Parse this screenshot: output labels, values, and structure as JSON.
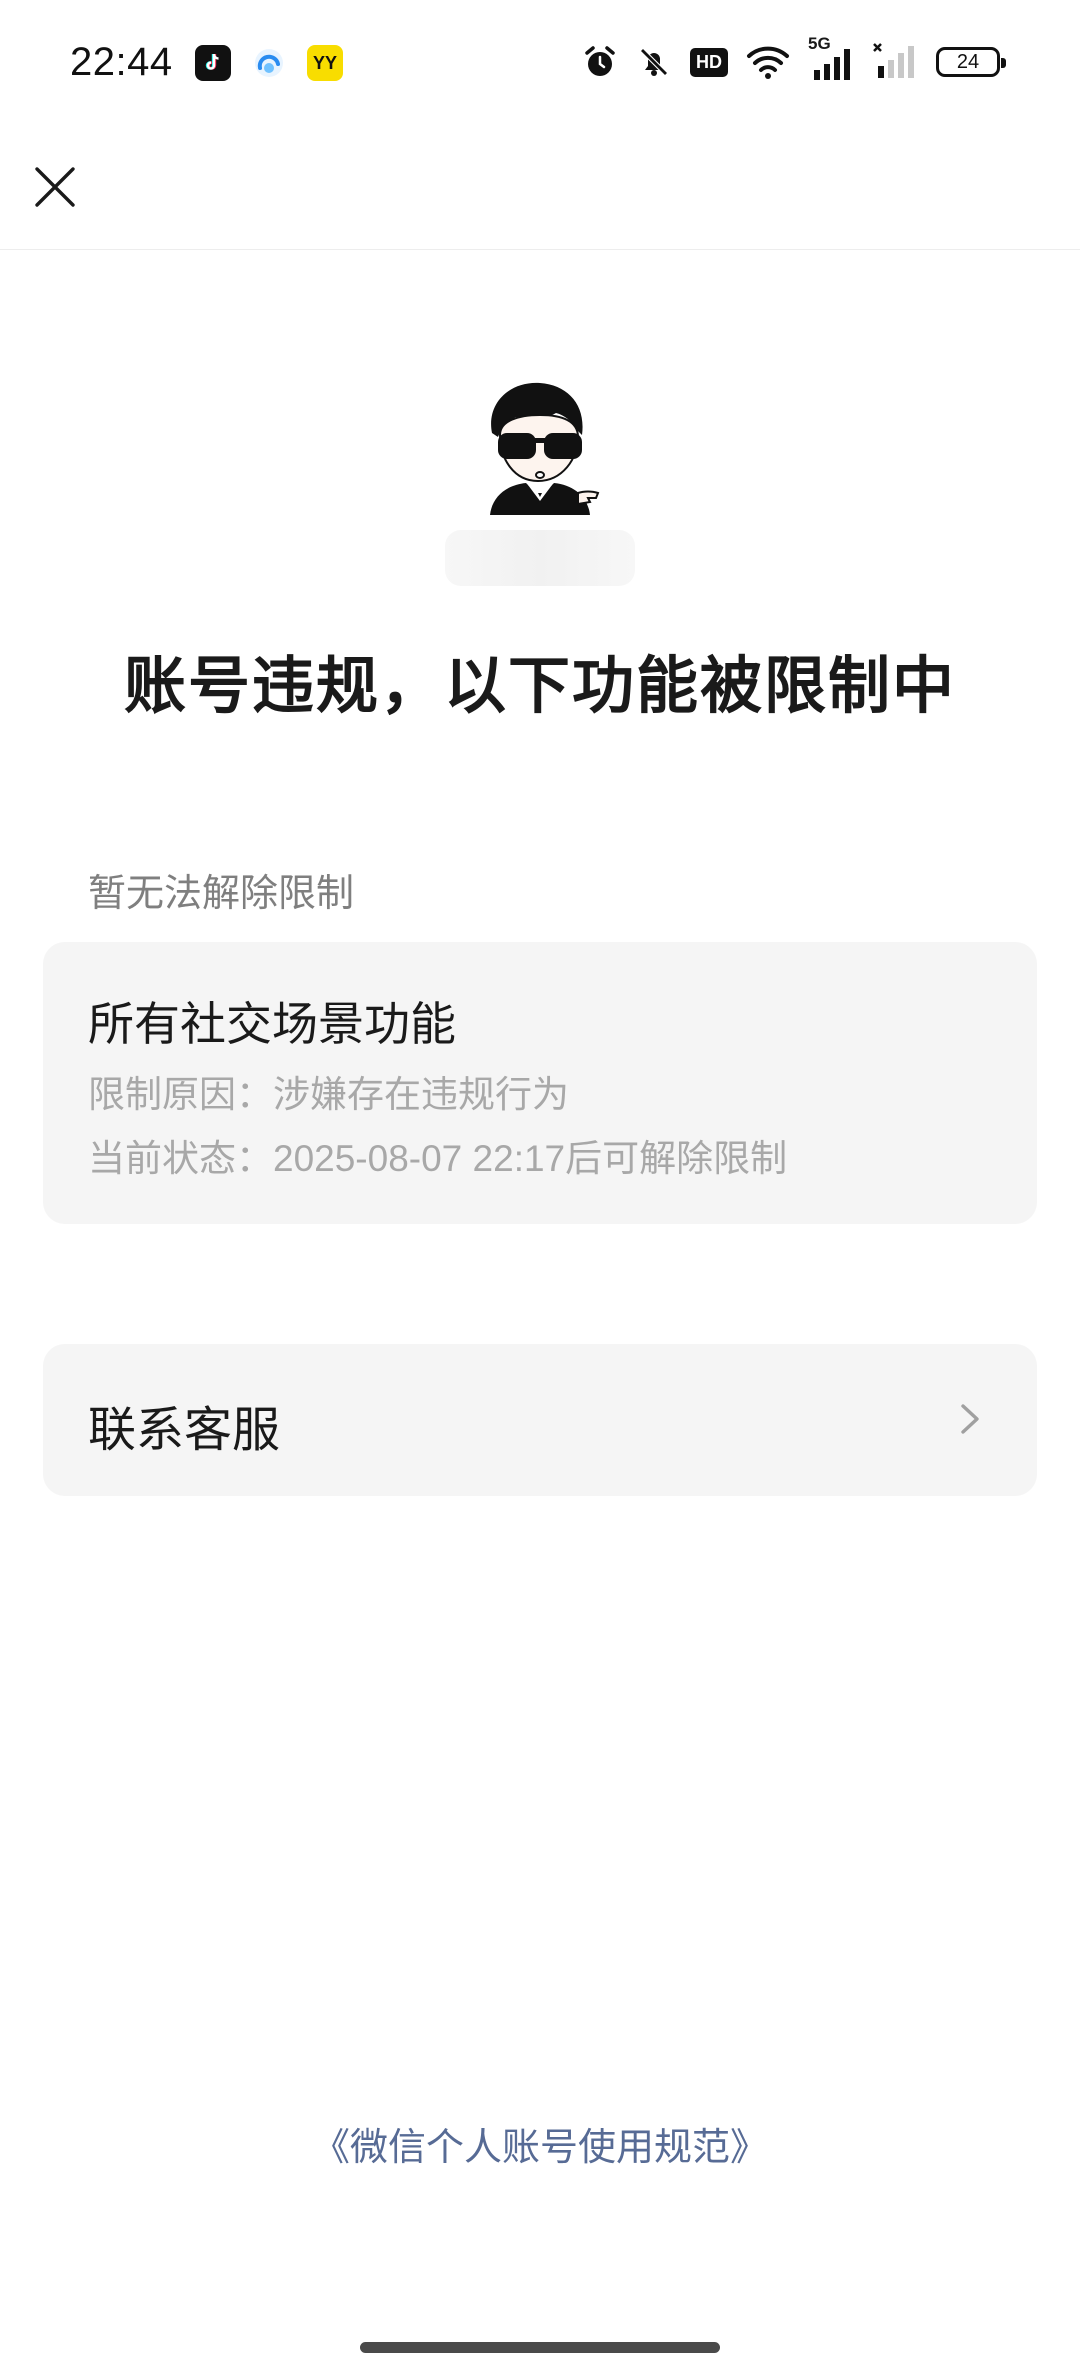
{
  "status_bar": {
    "time": "22:44",
    "app_icons": [
      "tiktok-icon",
      "cloud-icon",
      "yy-icon"
    ],
    "yy_label": "YY",
    "hd_label": "HD",
    "network_label": "5G",
    "battery_level": "24"
  },
  "nav": {
    "close_icon": "close-icon"
  },
  "header": {
    "title": "账号违规，以下功能被限制中"
  },
  "restrictions": {
    "section_label": "暂无法解除限制",
    "card": {
      "title": "所有社交场景功能",
      "reason": "限制原因：涉嫌存在违规行为",
      "status": "当前状态：2025-08-07 22:17后可解除限制"
    }
  },
  "service": {
    "label": "联系客服",
    "chevron_icon": "chevron-right-icon"
  },
  "footer": {
    "link": "《微信个人账号使用规范》"
  },
  "colors": {
    "link": "#576b95",
    "card_bg": "#f5f5f5",
    "muted_text": "#a8a8a8"
  }
}
